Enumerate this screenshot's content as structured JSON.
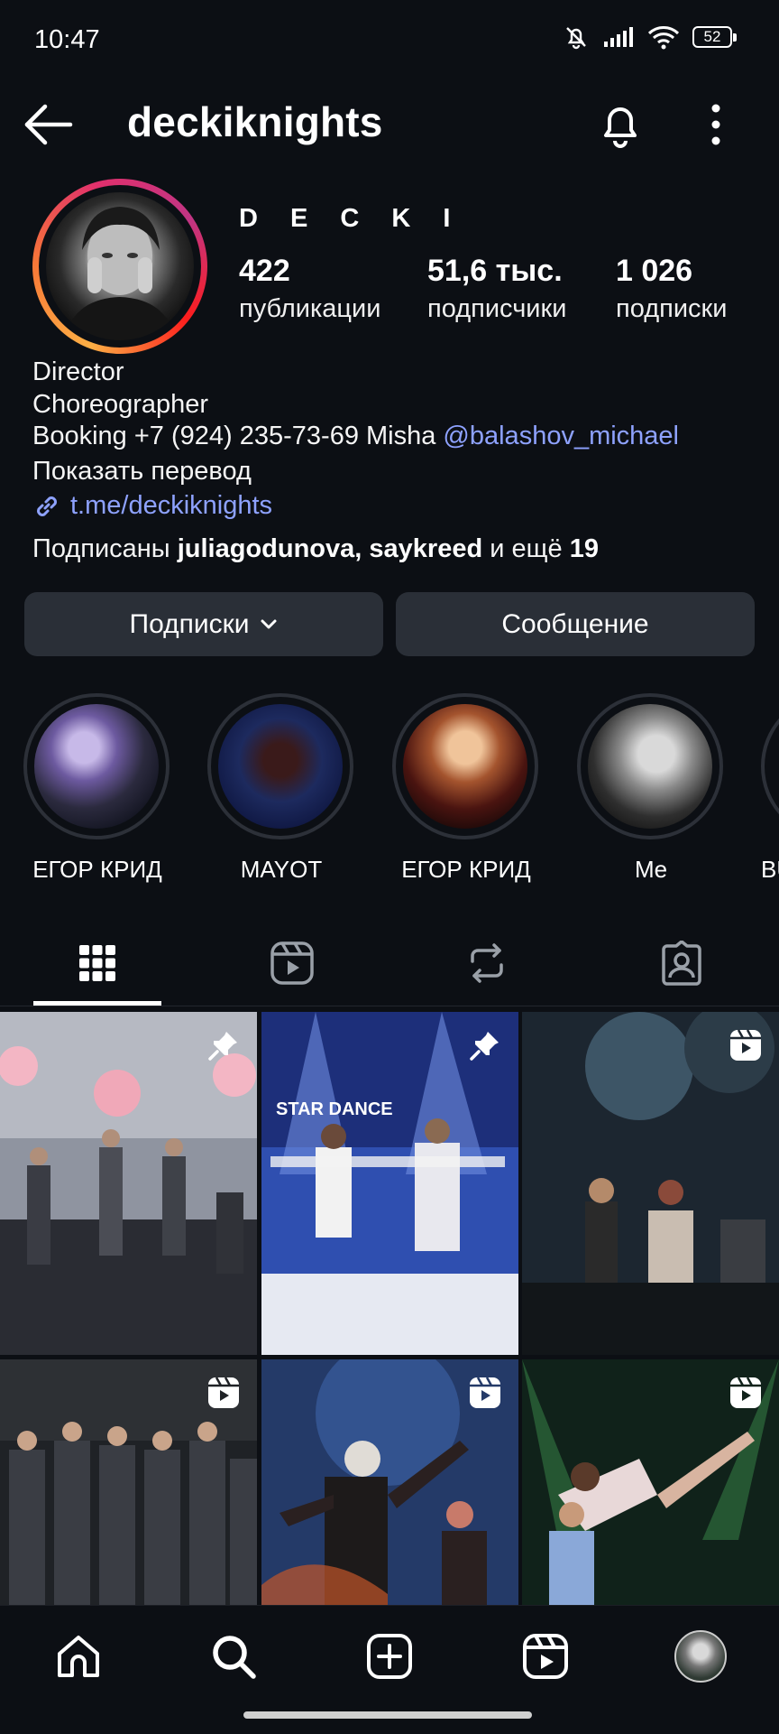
{
  "status": {
    "time": "10:47",
    "battery": "52"
  },
  "header": {
    "username": "deckiknights"
  },
  "profile": {
    "display_name": "D E C K I",
    "stats": [
      {
        "value": "422",
        "label": "публикации"
      },
      {
        "value": "51,6 тыс.",
        "label": "подписчики"
      },
      {
        "value": "1 026",
        "label": "подписки"
      }
    ],
    "bio": {
      "line1": "Director",
      "line2": "Choreographer",
      "line3_text": "Booking +7 (924) 235-73-69 Misha ",
      "line3_mention": "@balashov_michael",
      "translate": "Показать перевод",
      "link": "t.me/deckiknights"
    },
    "followed_by": {
      "prefix": "Подписаны ",
      "user1": "juliagodunova",
      "sep": ", ",
      "user2": "saykreed",
      "mid": " и ещё ",
      "count": "19"
    }
  },
  "actions": {
    "following_label": "Подписки",
    "message_label": "Сообщение"
  },
  "highlights": [
    {
      "label": "ЕГОР КРИД"
    },
    {
      "label": "MAYOT"
    },
    {
      "label": "ЕГОР КРИД"
    },
    {
      "label": "Me"
    },
    {
      "label": "BU"
    }
  ],
  "tabs": [
    "grid-icon",
    "reels-icon",
    "reposts-icon",
    "tagged-icon"
  ],
  "grid": {
    "posts": [
      {
        "badge": "pin-icon",
        "overlay_text": ""
      },
      {
        "badge": "pin-icon",
        "overlay_text": "STAR DANCE"
      },
      {
        "badge": "reel-icon",
        "overlay_text": ""
      },
      {
        "badge": "reel-icon",
        "overlay_text": ""
      },
      {
        "badge": "reel-icon",
        "overlay_text": ""
      },
      {
        "badge": "reel-icon",
        "overlay_text": ""
      }
    ]
  },
  "bottom_nav": [
    "home-icon",
    "search-icon",
    "create-icon",
    "reels-icon",
    "profile-avatar"
  ],
  "colors": {
    "background": "#0c0f14",
    "button": "#2a2f37",
    "link": "#8ea2ff"
  }
}
